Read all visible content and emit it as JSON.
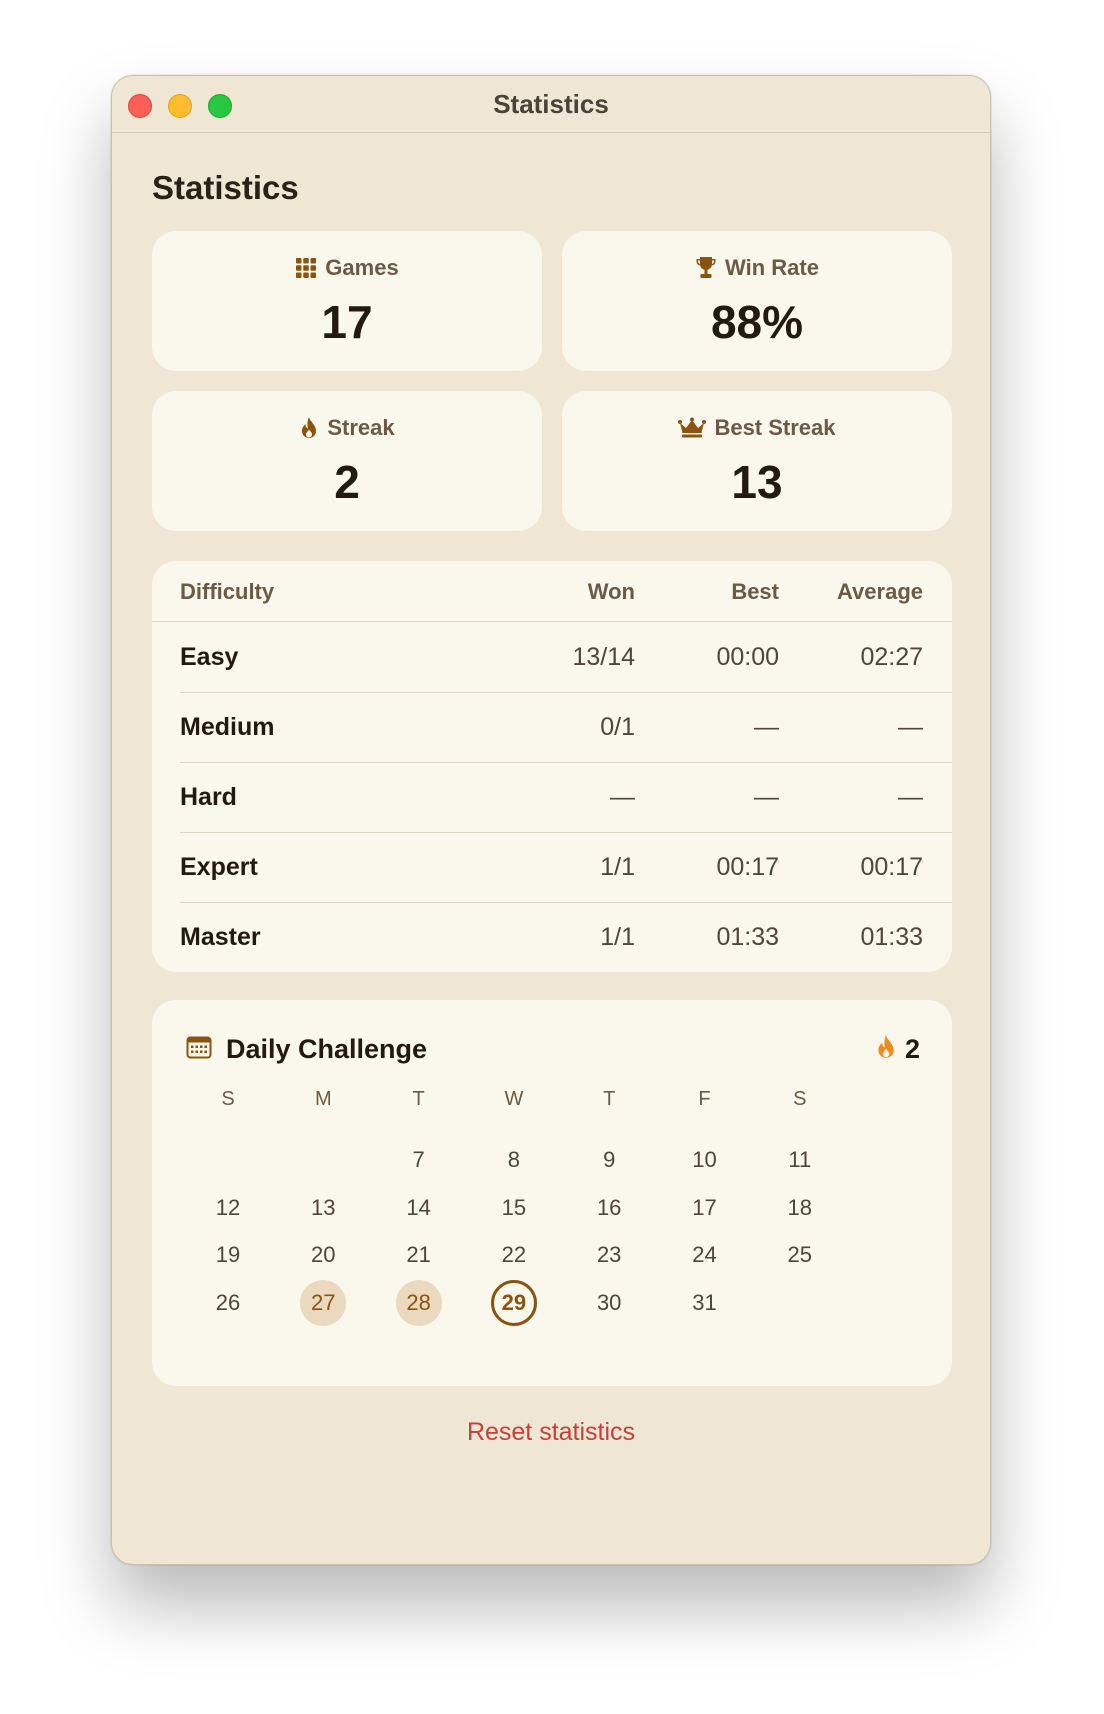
{
  "window": {
    "title": "Statistics"
  },
  "page_title": "Statistics",
  "stats": [
    {
      "label": "Games",
      "value": "17",
      "icon": "grid-icon"
    },
    {
      "label": "Win Rate",
      "value": "88%",
      "icon": "trophy-icon"
    },
    {
      "label": "Streak",
      "value": "2",
      "icon": "flame-icon"
    },
    {
      "label": "Best Streak",
      "value": "13",
      "icon": "crown-icon"
    }
  ],
  "difficulty_table": {
    "headers": {
      "name": "Difficulty",
      "won": "Won",
      "best": "Best",
      "average": "Average"
    },
    "rows": [
      {
        "name": "Easy",
        "won": "13/14",
        "best": "00:00",
        "average": "02:27"
      },
      {
        "name": "Medium",
        "won": "0/1",
        "best": "—",
        "average": "—"
      },
      {
        "name": "Hard",
        "won": "—",
        "best": "—",
        "average": "—"
      },
      {
        "name": "Expert",
        "won": "1/1",
        "best": "00:17",
        "average": "00:17"
      },
      {
        "name": "Master",
        "won": "1/1",
        "best": "01:33",
        "average": "01:33"
      }
    ]
  },
  "daily": {
    "title": "Daily Challenge",
    "streak": "2",
    "weekdays": [
      "S",
      "M",
      "T",
      "W",
      "T",
      "F",
      "S"
    ],
    "weeks": [
      [
        "",
        "",
        "7",
        "8",
        "9",
        "10",
        "11"
      ],
      [
        "12",
        "13",
        "14",
        "15",
        "16",
        "17",
        "18"
      ],
      [
        "19",
        "20",
        "21",
        "22",
        "23",
        "24",
        "25"
      ],
      [
        "26",
        "27",
        "28",
        "29",
        "30",
        "31",
        ""
      ]
    ],
    "completed_days": [
      "27",
      "28"
    ],
    "today": "29"
  },
  "reset_label": "Reset statistics",
  "colors": {
    "accent": "#8a5410",
    "flame": "#f08a1c",
    "reset": "#c4403a",
    "background": "#f0e6d4",
    "card": "#faf7ec"
  }
}
